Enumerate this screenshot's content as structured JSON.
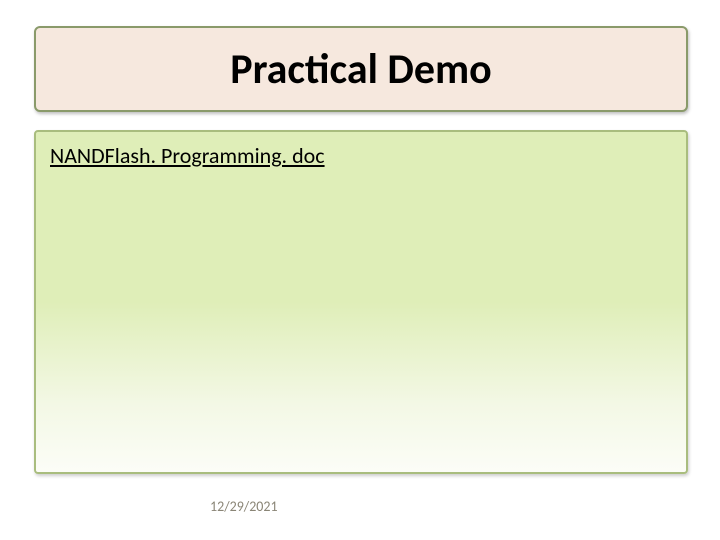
{
  "title": "Practical Demo",
  "document_link": "NANDFlash. Programming. doc",
  "footer": {
    "date": "12/29/2021"
  }
}
